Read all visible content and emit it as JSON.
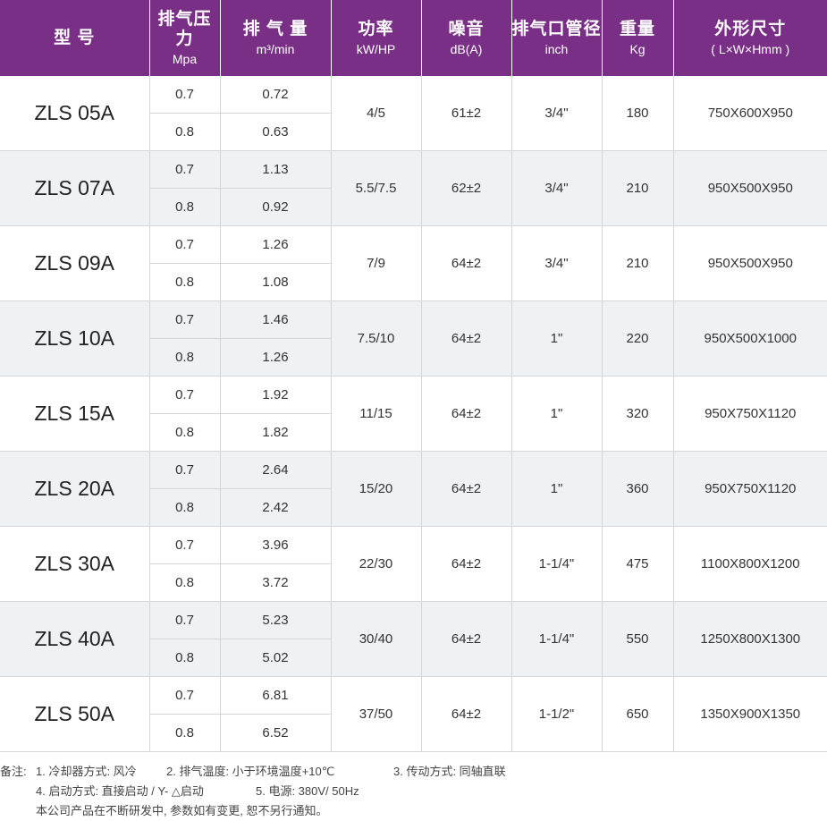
{
  "headers": [
    {
      "main": "型 号",
      "sub": ""
    },
    {
      "main": "排气压力",
      "sub": "Mpa"
    },
    {
      "main": "排 气 量",
      "sub": "m³/min"
    },
    {
      "main": "功率",
      "sub": "kW/HP"
    },
    {
      "main": "噪音",
      "sub": "dB(A)"
    },
    {
      "main": "排气口管径",
      "sub": "inch"
    },
    {
      "main": "重量",
      "sub": "Kg"
    },
    {
      "main": "外形尺寸",
      "sub": "( L×W×Hmm )"
    }
  ],
  "rows": [
    {
      "model": "ZLS 05A",
      "p1": "0.7",
      "f1": "0.72",
      "p2": "0.8",
      "f2": "0.63",
      "power": "4/5",
      "noise": "61±2",
      "port": "3/4\"",
      "weight": "180",
      "dims": "750X600X950"
    },
    {
      "model": "ZLS 07A",
      "p1": "0.7",
      "f1": "1.13",
      "p2": "0.8",
      "f2": "0.92",
      "power": "5.5/7.5",
      "noise": "62±2",
      "port": "3/4\"",
      "weight": "210",
      "dims": "950X500X950"
    },
    {
      "model": "ZLS 09A",
      "p1": "0.7",
      "f1": "1.26",
      "p2": "0.8",
      "f2": "1.08",
      "power": "7/9",
      "noise": "64±2",
      "port": "3/4\"",
      "weight": "210",
      "dims": "950X500X950"
    },
    {
      "model": "ZLS 10A",
      "p1": "0.7",
      "f1": "1.46",
      "p2": "0.8",
      "f2": "1.26",
      "power": "7.5/10",
      "noise": "64±2",
      "port": "1\"",
      "weight": "220",
      "dims": "950X500X1000"
    },
    {
      "model": "ZLS 15A",
      "p1": "0.7",
      "f1": "1.92",
      "p2": "0.8",
      "f2": "1.82",
      "power": "11/15",
      "noise": "64±2",
      "port": "1\"",
      "weight": "320",
      "dims": "950X750X1120"
    },
    {
      "model": "ZLS 20A",
      "p1": "0.7",
      "f1": "2.64",
      "p2": "0.8",
      "f2": "2.42",
      "power": "15/20",
      "noise": "64±2",
      "port": "1\"",
      "weight": "360",
      "dims": "950X750X1120"
    },
    {
      "model": "ZLS 30A",
      "p1": "0.7",
      "f1": "3.96",
      "p2": "0.8",
      "f2": "3.72",
      "power": "22/30",
      "noise": "64±2",
      "port": "1-1/4\"",
      "weight": "475",
      "dims": "1100X800X1200"
    },
    {
      "model": "ZLS 40A",
      "p1": "0.7",
      "f1": "5.23",
      "p2": "0.8",
      "f2": "5.02",
      "power": "30/40",
      "noise": "64±2",
      "port": "1-1/4\"",
      "weight": "550",
      "dims": "1250X800X1300"
    },
    {
      "model": "ZLS 50A",
      "p1": "0.7",
      "f1": "6.81",
      "p2": "0.8",
      "f2": "6.52",
      "power": "37/50",
      "noise": "64±2",
      "port": "1-1/2\"",
      "weight": "650",
      "dims": "1350X900X1350"
    }
  ],
  "notes": {
    "prefix": "备注:",
    "n1": "1. 冷却器方式: 风冷",
    "n2": "2. 排气温度: 小于环境温度+10℃",
    "n3": "3. 传动方式: 同轴直联",
    "n4": "4. 启动方式: 直接启动 / Y- △启动",
    "n5": "5. 电源: 380V/ 50Hz",
    "disclaimer": "本公司产品在不断研发中, 参数如有变更, 恕不另行通知。"
  },
  "colors": {
    "header_bg": "#7a2f86",
    "alt_row_bg": "#eef2f2"
  }
}
